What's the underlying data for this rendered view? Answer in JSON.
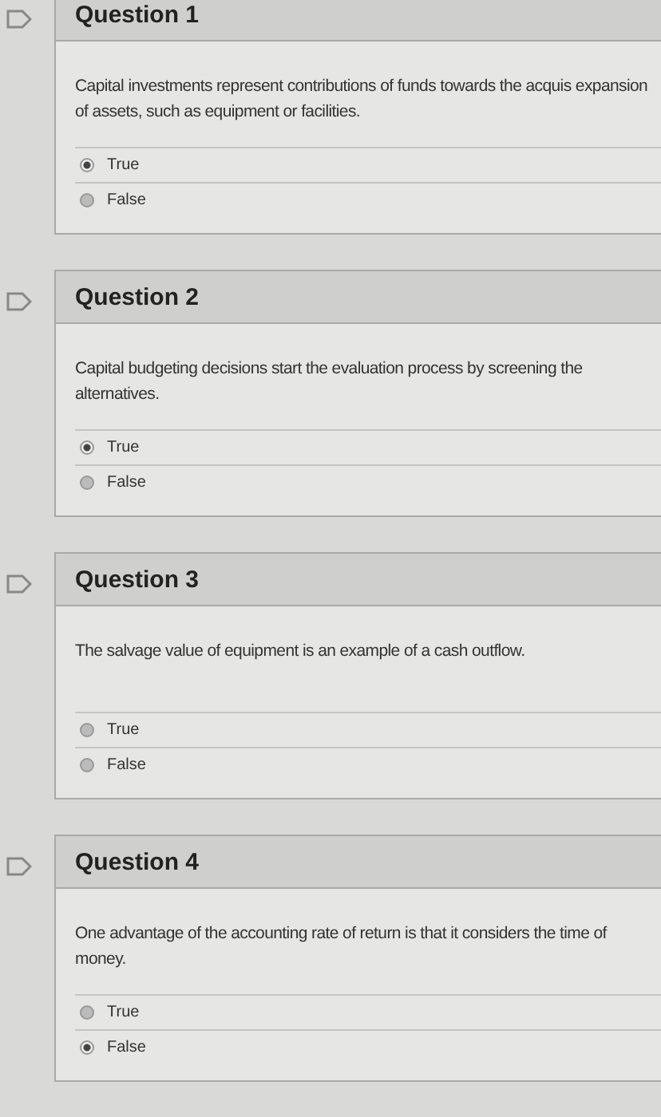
{
  "questions": [
    {
      "title": "Question 1",
      "prompt": "Capital investments represent contributions of funds towards the acquis expansion of assets, such as equipment or facilities.",
      "options": [
        {
          "label": "True",
          "selected": true
        },
        {
          "label": "False",
          "selected": false
        }
      ]
    },
    {
      "title": "Question 2",
      "prompt": "Capital budgeting decisions start the evaluation process by screening the alternatives.",
      "options": [
        {
          "label": "True",
          "selected": true
        },
        {
          "label": "False",
          "selected": false
        }
      ]
    },
    {
      "title": "Question 3",
      "prompt": "The salvage value of equipment is an example of a cash outflow.",
      "options": [
        {
          "label": "True",
          "selected": false
        },
        {
          "label": "False",
          "selected": false
        }
      ]
    },
    {
      "title": "Question 4",
      "prompt": "One advantage of the accounting rate of return is that it considers the time of money.",
      "options": [
        {
          "label": "True",
          "selected": false
        },
        {
          "label": "False",
          "selected": true
        }
      ]
    }
  ]
}
